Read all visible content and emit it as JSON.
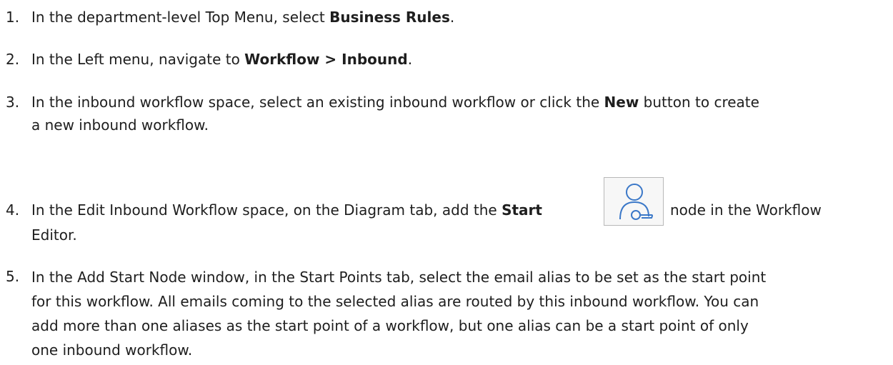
{
  "steps": [
    {
      "number": "1.",
      "pre": "In the department-level Top Menu, select ",
      "bold": "Business Rules",
      "post": "."
    },
    {
      "number": "2.",
      "pre": "In the Left menu, navigate to ",
      "bold": "Workflow > Inbound",
      "post": "."
    },
    {
      "number": "3.",
      "line1_pre": "In the inbound workflow space, select an existing inbound workflow or click the ",
      "bold": "New",
      "line1_post": " button to create",
      "line2": "a new inbound workflow."
    },
    {
      "number": "4.",
      "pre": "In the Edit Inbound Workflow space, on the Diagram tab, add the ",
      "bold": "Start",
      "post": " node in the Workflow",
      "line2": "Editor.",
      "icon": "start-node-icon"
    },
    {
      "number": "5.",
      "lines": [
        "In the Add Start Node window, in the Start Points tab, select the email alias to be set as the start point",
        "for this workflow. All emails coming to the selected alias are routed by this inbound workflow. You can",
        "add more than one aliases as the start point of a workflow, but one alias can be a start point of only",
        "one inbound workflow."
      ]
    }
  ],
  "colors": {
    "text": "#1e1e1e",
    "icon_stroke": "#3b78c8",
    "icon_border": "#b8b8b8"
  }
}
